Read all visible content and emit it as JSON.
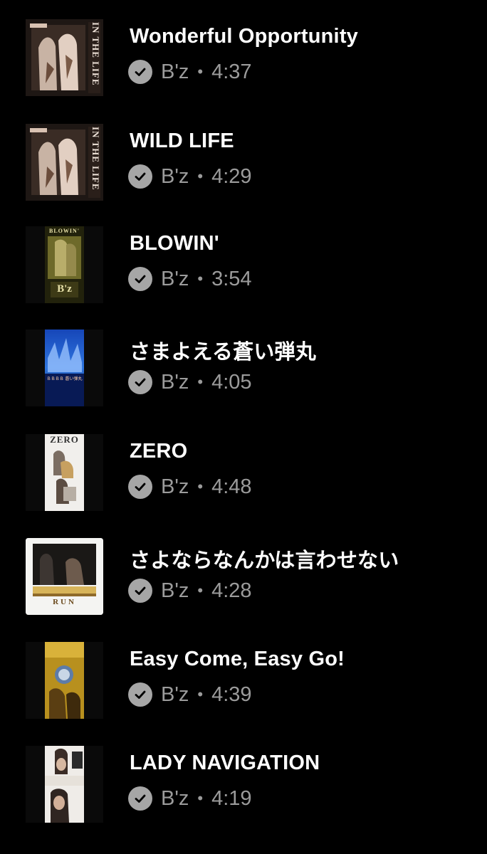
{
  "tracks": [
    {
      "title": "Wonderful Opportunity",
      "artist": "B'z",
      "duration": "4:37",
      "separator": "•",
      "artwork": "in-the-life-cover",
      "downloaded": true
    },
    {
      "title": "WILD LIFE",
      "artist": "B'z",
      "duration": "4:29",
      "separator": "•",
      "artwork": "in-the-life-cover",
      "downloaded": true
    },
    {
      "title": "BLOWIN'",
      "artist": "B'z",
      "duration": "3:54",
      "separator": "•",
      "artwork": "blowin-single-cover",
      "downloaded": true
    },
    {
      "title": "さまよえる蒼い弾丸",
      "artist": "B'z",
      "duration": "4:05",
      "separator": "•",
      "artwork": "samayoeru-aoi-dangan-cover",
      "downloaded": true
    },
    {
      "title": "ZERO",
      "artist": "B'z",
      "duration": "4:48",
      "separator": "•",
      "artwork": "zero-single-cover",
      "downloaded": true
    },
    {
      "title": "さよならなんかは言わせない",
      "artist": "B'z",
      "duration": "4:28",
      "separator": "•",
      "artwork": "run-album-cover",
      "downloaded": true
    },
    {
      "title": "Easy Come, Easy Go!",
      "artist": "B'z",
      "duration": "4:39",
      "separator": "•",
      "artwork": "easy-come-easy-go-cover",
      "downloaded": true
    },
    {
      "title": "LADY NAVIGATION",
      "artist": "B'z",
      "duration": "4:19",
      "separator": "•",
      "artwork": "lady-navigation-cover",
      "downloaded": true
    }
  ],
  "artwork_text": {
    "in_the_life": "IN THE LIFE",
    "blowin": "BLOWIN'",
    "samayoeru": "さまよえる蒼い弾丸",
    "samayoeru_small": "ＢＢＢＢ 蒼い弾丸",
    "zero": "ZERO",
    "run": "RUN",
    "bz": "B'z"
  },
  "colors": {
    "background": "#000000",
    "title": "#ffffff",
    "meta": "#9b9b9b",
    "check_badge": "#a6a6a6"
  }
}
